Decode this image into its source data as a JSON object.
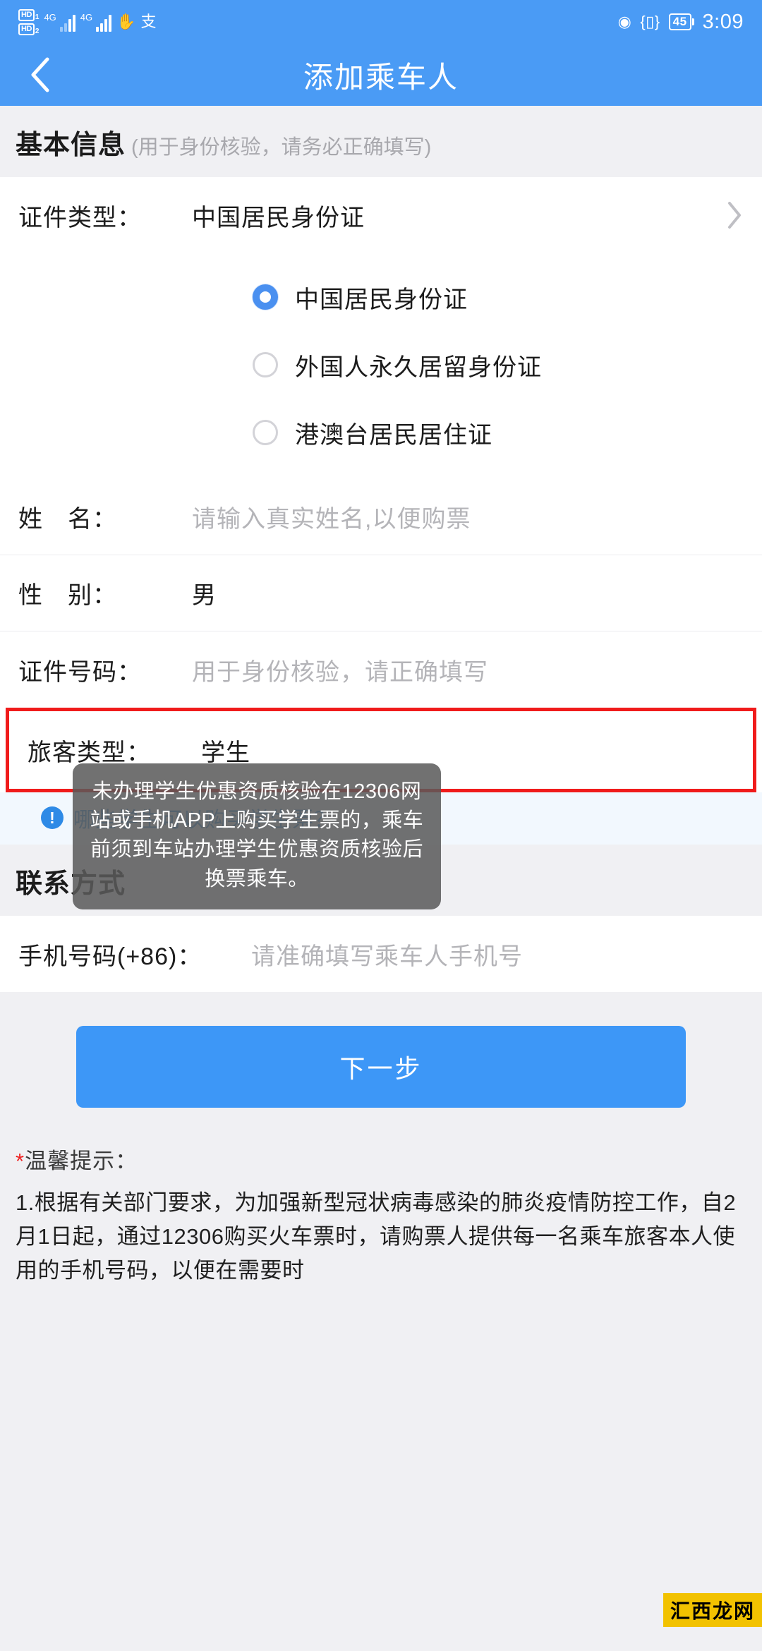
{
  "status_bar": {
    "hd1": "HD",
    "hd1_sub": "1",
    "hd2": "HD",
    "hd2_sub": "2",
    "net1": "4G",
    "net2": "4G",
    "hand_icon": "hand-icon",
    "alipay_icon": "alipay-icon",
    "eye_icon": "eye-icon",
    "vibrate_icon": "vibrate-icon",
    "battery": "45",
    "time": "3:09"
  },
  "navbar": {
    "back_icon": "back-chevron-icon",
    "title": "添加乘车人"
  },
  "basic_section": {
    "title": "基本信息",
    "subtitle": "(用于身份核验，请务必正确填写)",
    "id_type": {
      "label": "证件类型：",
      "value": "中国居民身份证",
      "chevron_icon": "chevron-right-icon"
    },
    "id_type_options": [
      {
        "label": "中国居民身份证",
        "selected": true
      },
      {
        "label": "外国人永久居留身份证",
        "selected": false
      },
      {
        "label": "港澳台居民居住证",
        "selected": false
      }
    ],
    "name": {
      "label": "姓　名：",
      "placeholder": "请输入真实姓名,以便购票",
      "value": ""
    },
    "gender": {
      "label": "性　别：",
      "value": "男"
    },
    "id_number": {
      "label": "证件号码：",
      "placeholder": "用于身份核验，请正确填写",
      "value": ""
    },
    "passenger_type": {
      "label": "旅客类型：",
      "value": "学生",
      "highlight_color": "#f01b1b"
    },
    "student_link": {
      "icon": "info-icon",
      "icon_text": "!",
      "text": "哪些学生可以购买学生票？"
    }
  },
  "contact_section": {
    "title": "联系方式",
    "phone": {
      "label": "手机号码(+86)：",
      "placeholder": "请准确填写乘车人手机号",
      "value": ""
    }
  },
  "next_button": {
    "label": "下一步",
    "color": "#3d97f7"
  },
  "tips": {
    "title_star": "*",
    "title": "温馨提示：",
    "body": "1.根据有关部门要求，为加强新型冠状病毒感染的肺炎疫情防控工作，自2月1日起，通过12306购买火车票时，请购票人提供每一名乘车旅客本人使用的手机号码，以便在需要时"
  },
  "tooltip": {
    "text": "未办理学生优惠资质核验在12306网站或手机APP上购买学生票的，乘车前须到车站办理学生优惠资质核验后换票乘车。"
  },
  "watermark": {
    "text": "汇西龙网"
  }
}
